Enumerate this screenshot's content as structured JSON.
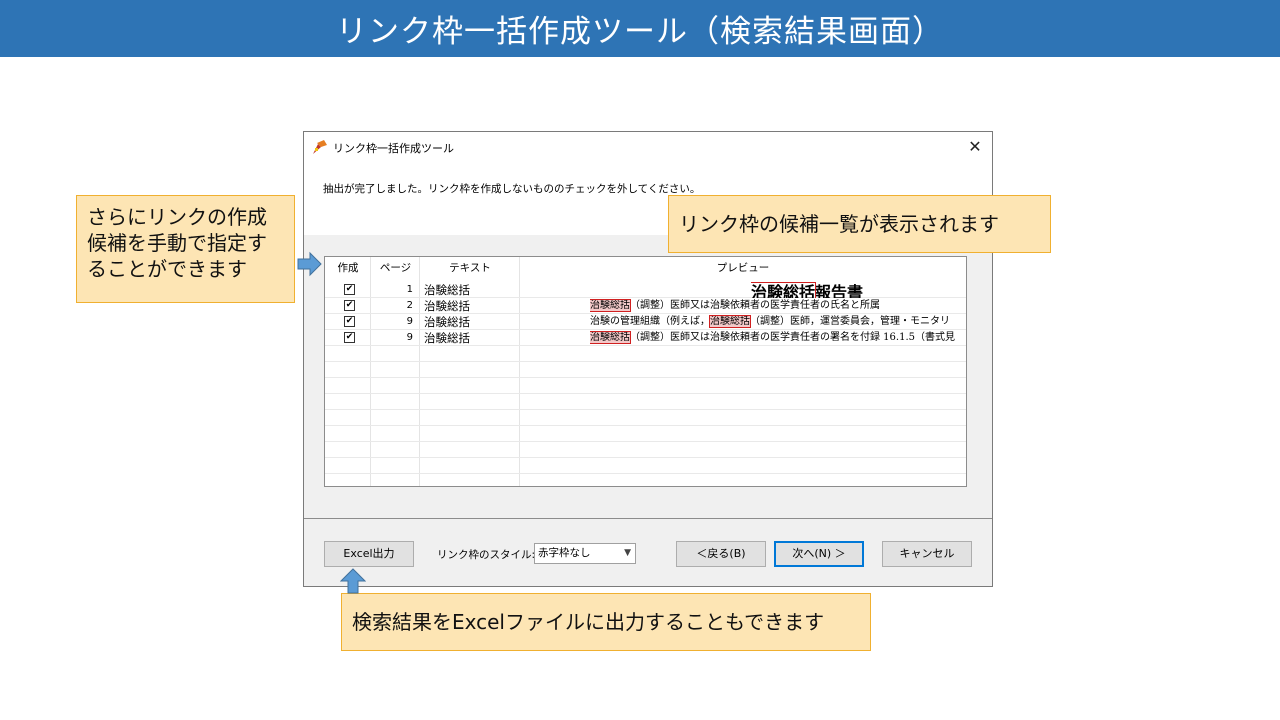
{
  "banner": {
    "title": "リンク枠一括作成ツール（検索結果画面）"
  },
  "dialog": {
    "title": "リンク枠一括作成ツール",
    "close_glyph": "✕",
    "instruction": "抽出が完了しました。リンク枠を作成しないもののチェックを外してください。",
    "columns": {
      "create": "作成",
      "page": "ページ",
      "text": "テキスト",
      "preview": "プレビュー"
    },
    "rows": [
      {
        "checked": true,
        "page": "1",
        "text": "治験総括",
        "preview_pre": "",
        "preview_hl": "治験総括",
        "preview_post": "報告書"
      },
      {
        "checked": true,
        "page": "2",
        "text": "治験総括",
        "preview_pre": "",
        "preview_hl": "治験総括",
        "preview_post": "（調整）医師又は治験依頼者の医学責任者の氏名と所属"
      },
      {
        "checked": true,
        "page": "9",
        "text": "治験総括",
        "preview_pre": "治験の管理組織（例えば，",
        "preview_hl": "治験総括",
        "preview_post": "（調整）医師，運営委員会，管理・モニタリ"
      },
      {
        "checked": true,
        "page": "9",
        "text": "治験総括",
        "preview_pre": "",
        "preview_hl": "治験総括",
        "preview_post": "（調整）医師又は治験依頼者の医学責任者の署名を付録 16.1.5（書式見"
      }
    ],
    "check_glyph": "✔",
    "footer": {
      "excel_button": "Excel出力",
      "style_label": "リンク枠のスタイル:",
      "style_value": "赤字枠なし",
      "back_button": "＜戻る(B)",
      "next_button": "次へ(N) ＞",
      "cancel_button": "キャンセル"
    }
  },
  "callouts": {
    "manual": "さらにリンクの作成候補を手動で指定することができます",
    "list": "リンク枠の候補一覧が表示されます",
    "excel": "検索結果をExcelファイルに出力することもできます"
  },
  "colors": {
    "banner": "#2e74b5",
    "callout_bg": "#fde5b4",
    "callout_border": "#f0b030",
    "highlight": "#d02020",
    "arrow": "#5b9bd5"
  }
}
